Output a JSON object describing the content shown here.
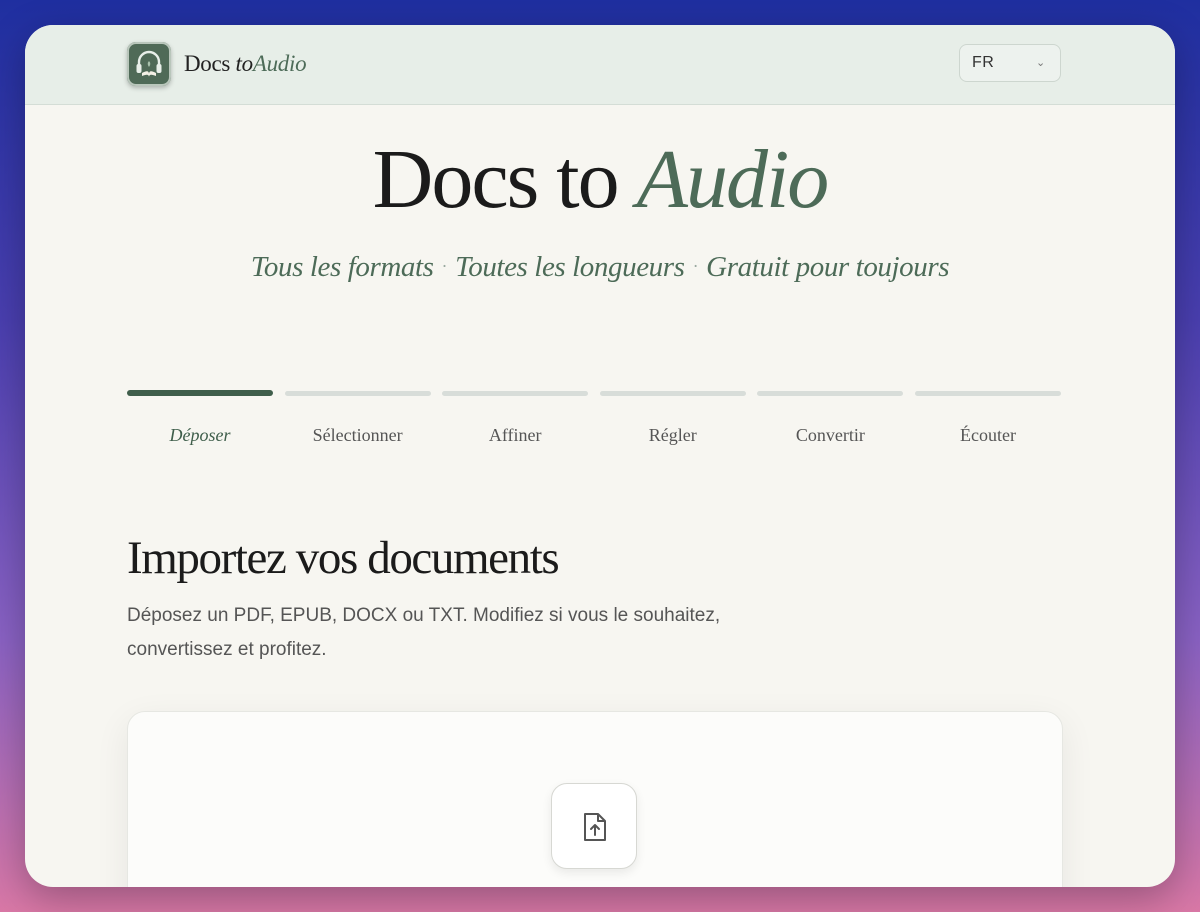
{
  "header": {
    "brand_main": "Docs",
    "brand_to": "to",
    "brand_accent": "Audio",
    "logo_icon": "headphones-book-icon",
    "language": "FR"
  },
  "hero": {
    "title_main": "Docs to",
    "title_accent": "Audio",
    "taglines": [
      "Tous les formats",
      "Toutes les longueurs",
      "Gratuit pour toujours"
    ],
    "separator": "·"
  },
  "steps": [
    {
      "label": "Déposer",
      "active": true
    },
    {
      "label": "Sélectionner",
      "active": false
    },
    {
      "label": "Affiner",
      "active": false
    },
    {
      "label": "Régler",
      "active": false
    },
    {
      "label": "Convertir",
      "active": false
    },
    {
      "label": "Écouter",
      "active": false
    }
  ],
  "upload": {
    "title": "Importez vos documents",
    "description": "Déposez un PDF, EPUB, DOCX ou TXT. Modifiez si vous le souhaitez, convertissez et profitez.",
    "icon": "file-upload-icon"
  },
  "colors": {
    "accent": "#4d6b58",
    "active_step": "#3f5e4b",
    "inactive_step": "#d8ddd9"
  }
}
